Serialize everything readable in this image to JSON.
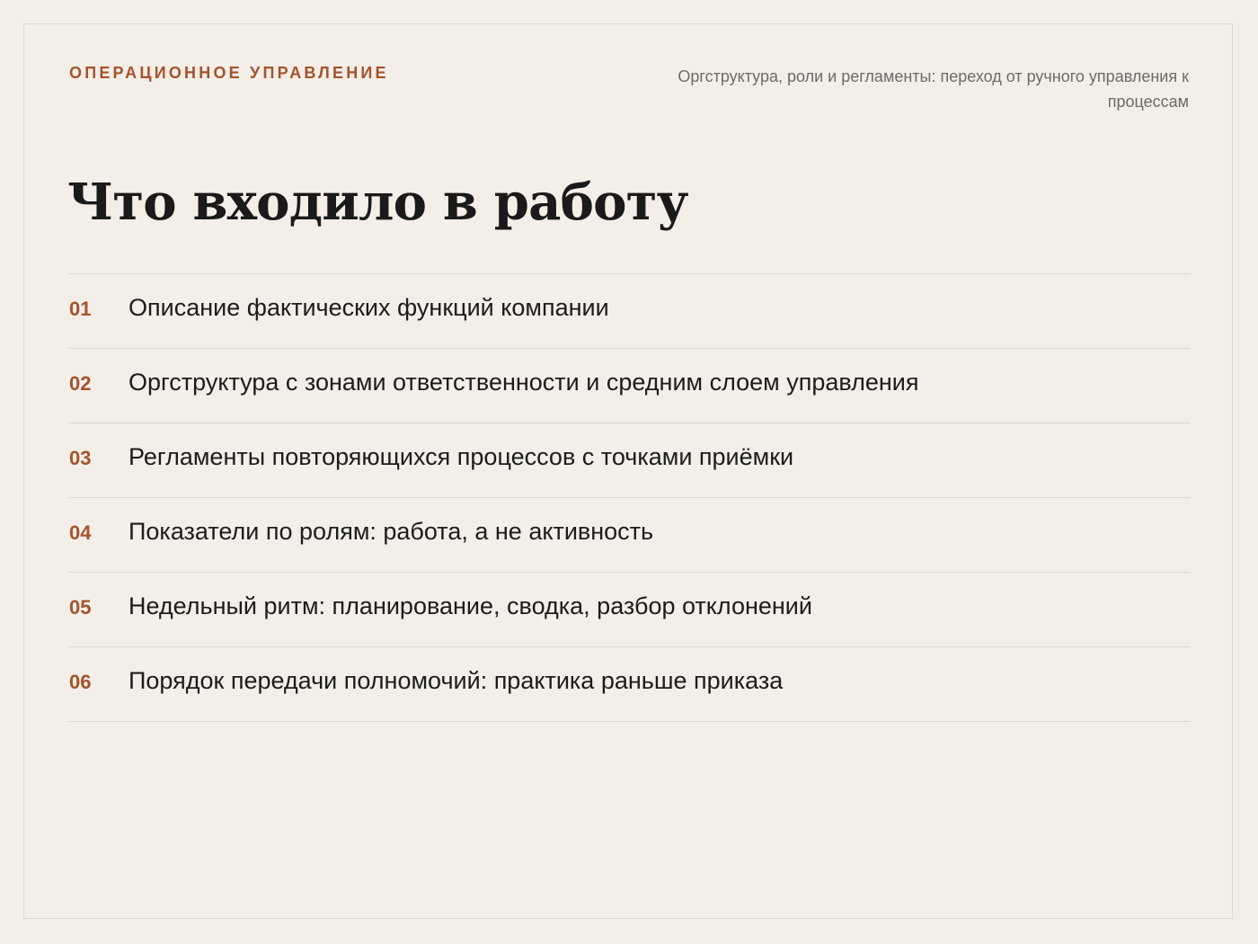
{
  "header": {
    "kicker": "ОПЕРАЦИОННОЕ УПРАВЛЕНИЕ",
    "subtitle": "Оргструктура, роли и регламенты: переход от ручного управления к процессам"
  },
  "main": {
    "title": "Что входило в работу",
    "items": [
      {
        "num": "01",
        "text": "Описание фактических функций компании"
      },
      {
        "num": "02",
        "text": "Оргструктура с зонами ответственности и средним слоем управления"
      },
      {
        "num": "03",
        "text": "Регламенты повторяющихся процессов с точками приёмки"
      },
      {
        "num": "04",
        "text": "Показатели по ролям: работа, а не активность"
      },
      {
        "num": "05",
        "text": "Недельный ритм: планирование, сводка, разбор отклонений"
      },
      {
        "num": "06",
        "text": "Порядок передачи полномочий: практика раньше приказа"
      }
    ]
  },
  "colors": {
    "background": "#f3eee8",
    "accent": "#a4532c",
    "text": "#1c1c1c",
    "muted": "#6e6a66",
    "divider": "#dcd6cf"
  }
}
